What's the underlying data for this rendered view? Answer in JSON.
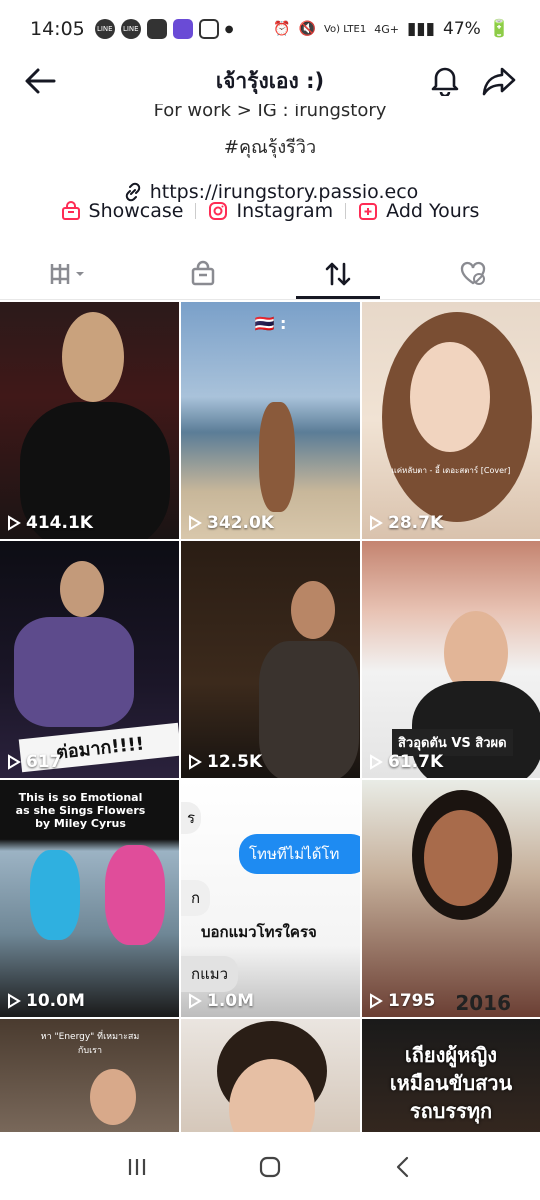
{
  "status_bar": {
    "time": "14:05",
    "network": "Vo) LTE1",
    "signal": "4G+",
    "battery": "47%"
  },
  "header": {
    "title": "เจ้ารุ้งเอง  :)"
  },
  "bio": {
    "line_cut": "For work > IG : irungstory",
    "hashtag": "#คุณรุ้งรีวิว",
    "link": "https://irungstory.passio.eco"
  },
  "quick_links": [
    {
      "label": "Showcase",
      "icon": "bag-icon"
    },
    {
      "label": "Instagram",
      "icon": "instagram-icon"
    },
    {
      "label": "Add Yours",
      "icon": "add-yours-icon"
    }
  ],
  "tabs": [
    {
      "name": "videos-grid",
      "icon": "grid-icon"
    },
    {
      "name": "showcase",
      "icon": "bag-icon"
    },
    {
      "name": "reposts",
      "icon": "repost-icon",
      "active": true
    },
    {
      "name": "liked",
      "icon": "liked-hidden-icon"
    }
  ],
  "videos": [
    {
      "views": "414.1K"
    },
    {
      "views": "342.0K",
      "overlay": "🇹🇭 :"
    },
    {
      "views": "28.7K",
      "overlay": "แค่หลับตา - อี้ เดอะสตาร์ [Cover]"
    },
    {
      "views": "617",
      "overlay": "ต่อมาก!!!!"
    },
    {
      "views": "12.5K"
    },
    {
      "views": "61.7K",
      "overlay": "สิวอุดตัน VS สิวผด"
    },
    {
      "views": "10.0M",
      "overlay": "This is so Emotional as she Sings Flowers by Miley Cyrus"
    },
    {
      "views": "1.0M",
      "overlay": "บอกแมวโทรใครจ",
      "chat1": "โทษทีไม่ได้โท",
      "chat2": "ก",
      "chat3": "กแมว",
      "chat4": "ร"
    },
    {
      "views": "1795",
      "overlay": "2016"
    },
    {
      "views": "",
      "overlay": "หา \"Energy\" ที่เหมาะสมกับเรา"
    },
    {
      "views": ""
    },
    {
      "views": "",
      "overlay": "เถียงผู้หญิง เหมือนขับสวน รถบรรทุก"
    }
  ]
}
